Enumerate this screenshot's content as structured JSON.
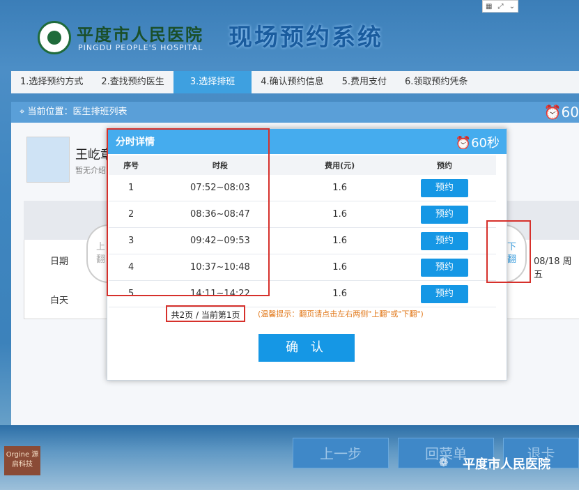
{
  "header": {
    "hospital_name": "平度市人民医院",
    "hospital_en": "PINGDU PEOPLE'S HOSPITAL",
    "system_title": "现场预约系统",
    "topbar_icons": [
      "grid-icon",
      "fullscreen-icon",
      "chevron-down-icon"
    ]
  },
  "steps": [
    {
      "label": "1.选择预约方式",
      "active": false
    },
    {
      "label": "2.查找预约医生",
      "active": false
    },
    {
      "label": "3.选择排班",
      "active": true
    },
    {
      "label": "4.确认预约信息",
      "active": false
    },
    {
      "label": "5.费用支付",
      "active": false
    },
    {
      "label": "6.领取预约凭条",
      "active": false
    }
  ],
  "location": {
    "label": "当前位置：医生排班列表",
    "timer": "60"
  },
  "doctor": {
    "name": "王屹章",
    "intro": "暂无介绍"
  },
  "schedule": {
    "date_label": "日期",
    "day_label": "白天",
    "last_date": "08/18 周五",
    "page_prev": "上翻",
    "page_next": "下翻"
  },
  "dialog": {
    "title": "分时详情",
    "timer": "60秒",
    "columns": [
      "序号",
      "时段",
      "费用(元)",
      "预约"
    ],
    "rows": [
      {
        "no": "1",
        "time": "07:52~08:03",
        "fee": "1.6",
        "action": "预约"
      },
      {
        "no": "2",
        "time": "08:36~08:47",
        "fee": "1.6",
        "action": "预约"
      },
      {
        "no": "3",
        "time": "09:42~09:53",
        "fee": "1.6",
        "action": "预约"
      },
      {
        "no": "4",
        "time": "10:37~10:48",
        "fee": "1.6",
        "action": "预约"
      },
      {
        "no": "5",
        "time": "14:11~14:22",
        "fee": "1.6",
        "action": "预约"
      }
    ],
    "page_info": "共2页 / 当前第1页",
    "tip": "(温馨提示：翻页请点击左右两侧\"上翻\"或\"下翻\")",
    "confirm_label": "确 认"
  },
  "bottom": {
    "prev_step": "上一步",
    "back_menu": "回菜单",
    "exit_card": "退卡",
    "brand": "Orgine\n源启科技",
    "watermark": "平度市人民医院"
  },
  "colors": {
    "accent": "#45acee",
    "button": "#1597e5",
    "highlight": "#d6302b",
    "tip": "#e27a1d"
  }
}
